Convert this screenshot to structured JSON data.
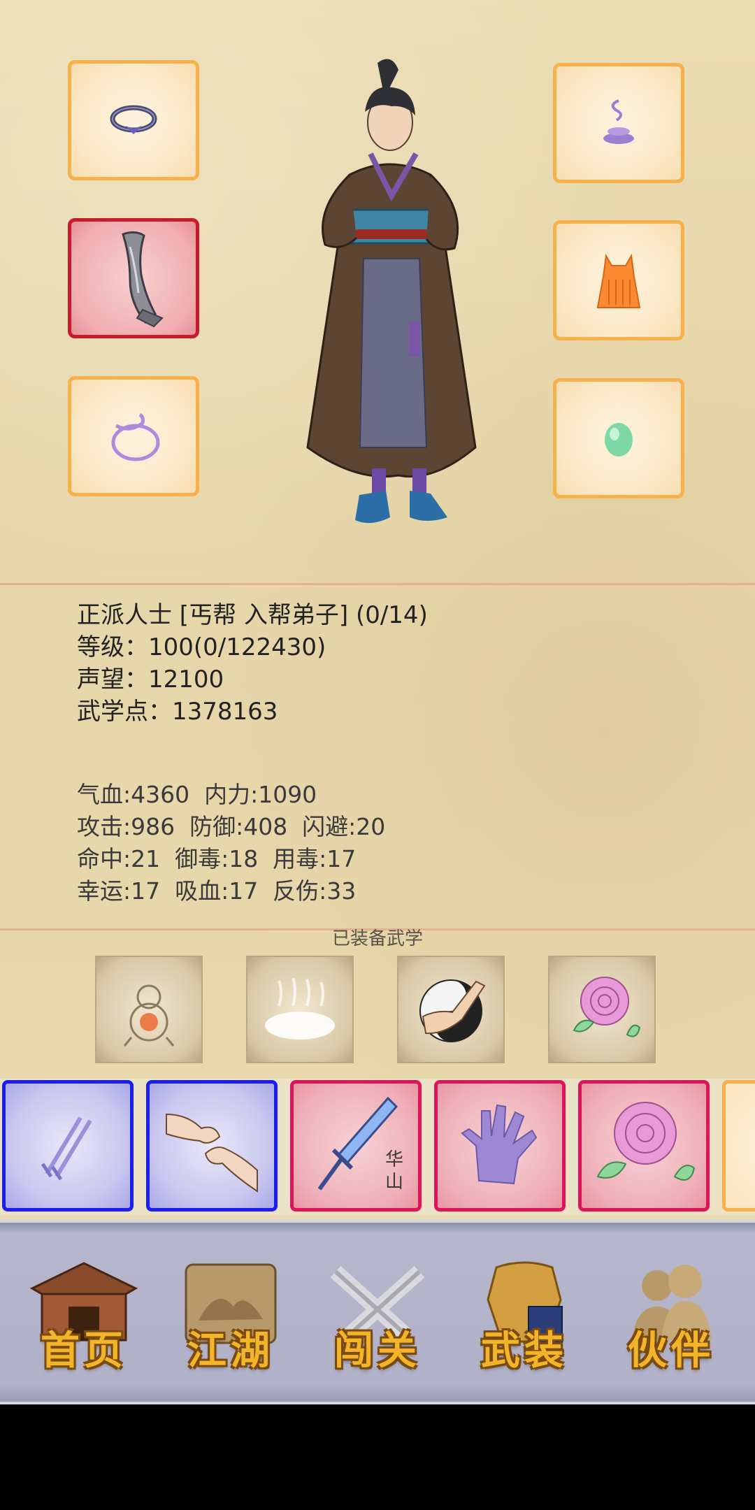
{
  "equipment": {
    "left_slots": [
      "ring-icon",
      "sword-icon",
      "bracelet-icon"
    ],
    "right_slots": [
      "incense-icon",
      "garment-icon",
      "jade-icon"
    ],
    "selected_slot": "sword-icon"
  },
  "character": {
    "faction_line": "正派人士 [丐帮 入帮弟子] (0/14)",
    "level_line": "等级：100(0/122430)",
    "reputation_line": "声望：12100",
    "martial_points_line": "武学点：1378163"
  },
  "stats": {
    "row1": "气血:4360  内力:1090",
    "row2": "攻击:986  防御:408  闪避:20",
    "row3": "命中:21  御毒:18  用毒:17",
    "row4": "幸运:17  吸血:17  反伤:33"
  },
  "equipped_martial": {
    "title": "已装备武学",
    "skills": [
      "gourd-icon",
      "mist-icon",
      "yin-yang-fist-icon",
      "peony-icon"
    ]
  },
  "skill_cards": [
    {
      "icon": "twin-blades-icon",
      "rarity": "blue"
    },
    {
      "icon": "fist-bump-icon",
      "rarity": "blue"
    },
    {
      "icon": "huashan-sword-icon",
      "rarity": "red",
      "text": "华山"
    },
    {
      "icon": "palm-icon",
      "rarity": "red"
    },
    {
      "icon": "peony-icon",
      "rarity": "red"
    },
    {
      "icon": "partial-icon",
      "rarity": "orange"
    }
  ],
  "nav": {
    "home": "首页",
    "jianghu": "江湖",
    "challenge": "闯关",
    "gear": "武装",
    "partner": "伙伴"
  },
  "colors": {
    "slot_border": "#f8b04a",
    "selected_border": "#c81b2c",
    "blue_rarity": "#1a1ef0",
    "red_rarity": "#e0145a",
    "nav_gold": "#f2b52a"
  }
}
